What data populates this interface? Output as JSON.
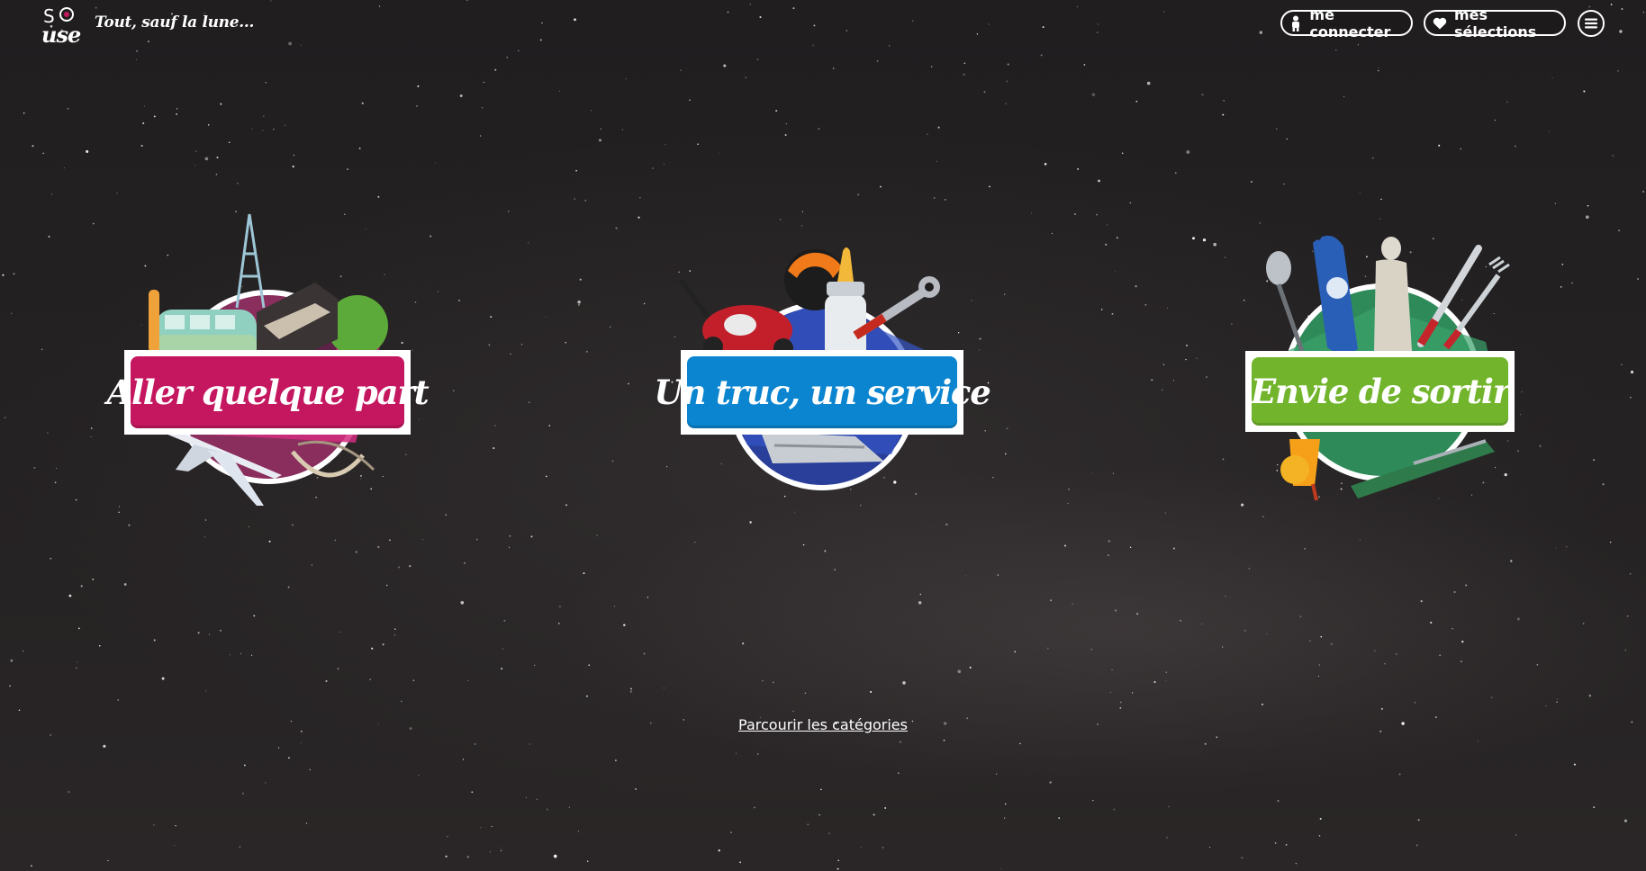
{
  "header": {
    "logo_text": "SO use",
    "tagline": "Tout, sauf la lune...",
    "login_label": "me connecter",
    "selections_label": "mes sélections",
    "menu_icon": "hamburger-icon"
  },
  "categories": [
    {
      "label": "Aller quelque part",
      "color": "#c4175f",
      "icons": [
        "van-icon",
        "eiffel-tower-icon",
        "bed-icon",
        "airplane-icon",
        "hammock-icon"
      ]
    },
    {
      "label": "Un truc, un service",
      "color": "#0b85cf",
      "icons": [
        "lawnmower-icon",
        "helmet-icon",
        "baby-bottle-icon",
        "wrench-icon",
        "iron-icon"
      ]
    },
    {
      "label": "Envie de sortir",
      "color": "#72b52c",
      "icons": [
        "microphone-icon",
        "skateboard-icon",
        "statue-icon",
        "cutlery-icon",
        "cocktail-icon",
        "bottle-icon"
      ]
    }
  ],
  "footer": {
    "browse_link": "Parcourir les catégories"
  }
}
